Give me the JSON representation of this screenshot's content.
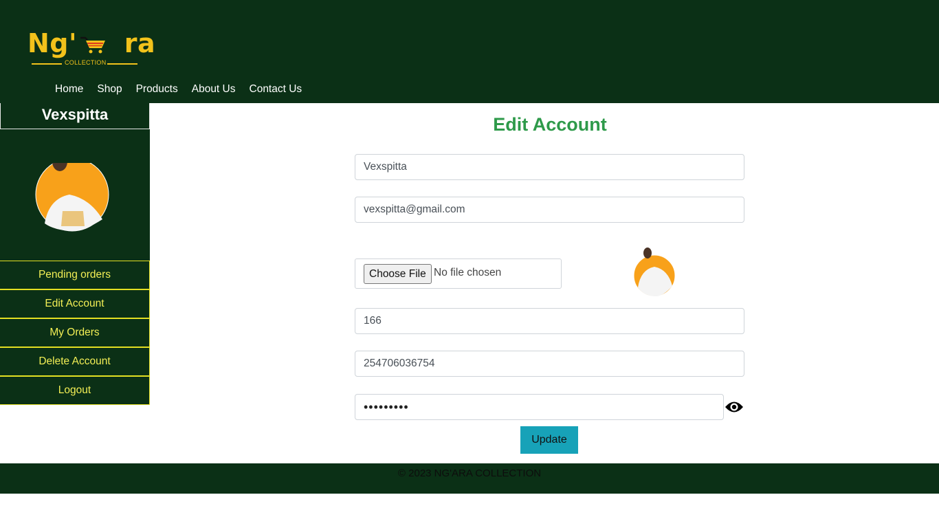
{
  "brand": {
    "logo_text": "Ng'ra",
    "logo_subtext": "COLLECTION",
    "color_primary": "#0b3016",
    "color_logo": "#f2c21b"
  },
  "nav": {
    "items": [
      "Home",
      "Shop",
      "Products",
      "About Us",
      "Contact Us"
    ]
  },
  "sidebar": {
    "username": "Vexspitta",
    "avatar_icon": "user-avatar",
    "menu": [
      "Pending orders",
      "Edit Account",
      "My Orders",
      "Delete Account",
      "Logout"
    ],
    "menu_text_color": "#f3ef55"
  },
  "form": {
    "title": "Edit Account",
    "title_color": "#2e9a4a",
    "username_value": "Vexspitta",
    "email_value": "vexspitta@gmail.com",
    "file_button": "Choose File",
    "file_status": "No file chosen",
    "field_166": "166",
    "phone_value": "254706036754",
    "password_masked": "•••••••••",
    "show_password_icon": "eye-icon",
    "update_label": "Update",
    "update_color": "#17a2b8"
  },
  "footer": {
    "text": "© 2023 NG'ARA COLLECTION"
  }
}
